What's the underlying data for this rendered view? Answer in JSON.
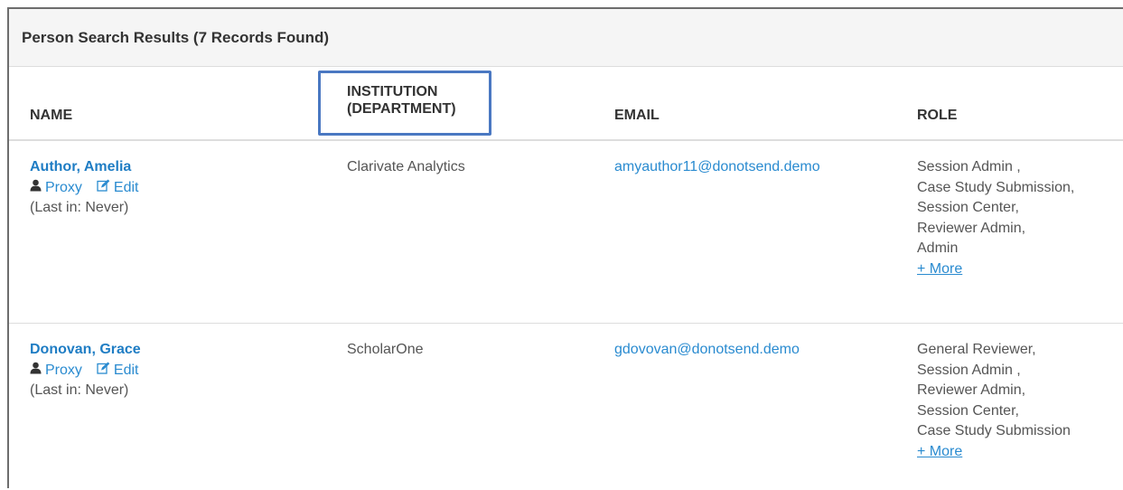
{
  "panel": {
    "title": "Person Search Results (7 Records Found)"
  },
  "table": {
    "headers": {
      "name": "NAME",
      "institution_line1": "INSTITUTION",
      "institution_line2": "(DEPARTMENT)",
      "email": "EMAIL",
      "role": "ROLE"
    },
    "rows": [
      {
        "name": "Author, Amelia",
        "proxy_label": "Proxy",
        "edit_label": "Edit",
        "last_in": "(Last in: Never)",
        "institution": "Clarivate Analytics",
        "email": "amyauthor11@donotsend.demo",
        "roles": [
          "Session Admin ,",
          "Case Study Submission,",
          "Session Center,",
          "Reviewer Admin,",
          "Admin"
        ],
        "more_label": "+ More"
      },
      {
        "name": "Donovan, Grace",
        "proxy_label": "Proxy",
        "edit_label": "Edit",
        "last_in": "(Last in: Never)",
        "institution": "ScholarOne",
        "email": "gdovovan@donotsend.demo",
        "roles": [
          "General Reviewer,",
          "Session Admin ,",
          "Reviewer Admin,",
          "Session Center,",
          "Case Study Submission"
        ],
        "more_label": "+ More"
      }
    ]
  },
  "colors": {
    "link": "#2a8bd0",
    "name_link": "#1f7dc4",
    "highlight": "#4a78c2",
    "text": "#555555",
    "header_text": "#333333"
  },
  "icons": {
    "proxy": "user-icon",
    "edit": "edit-icon"
  }
}
